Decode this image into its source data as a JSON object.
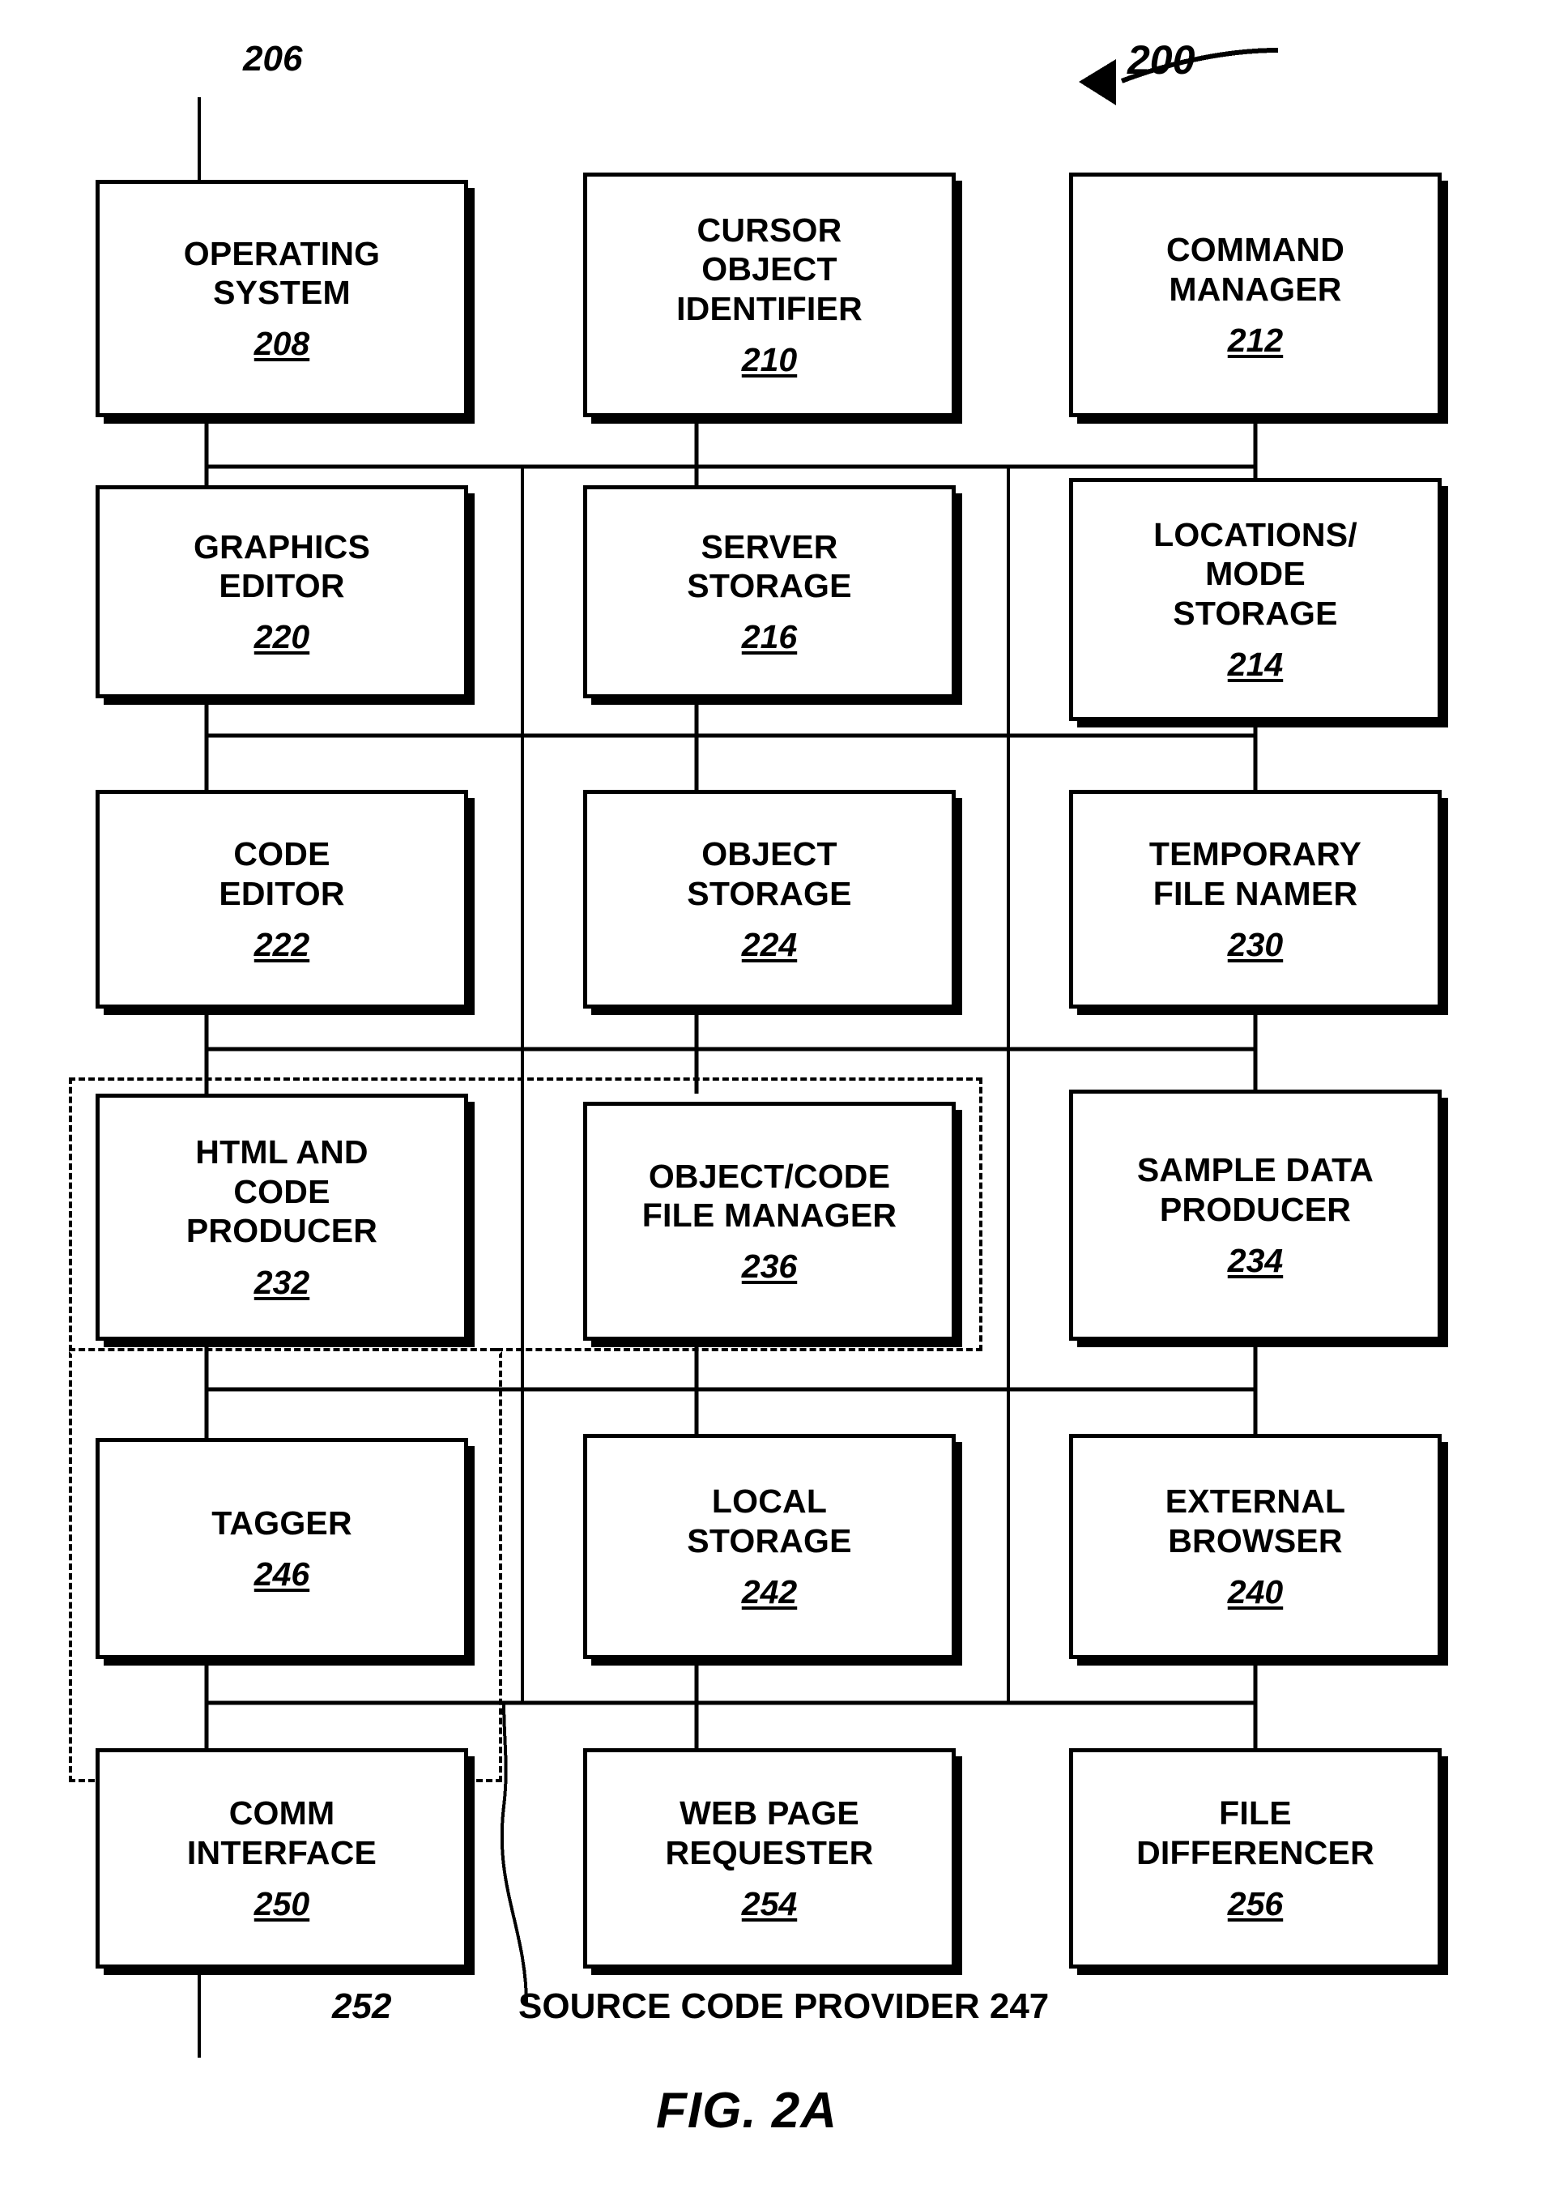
{
  "figure": {
    "caption": "FIG. 2A",
    "system_ref": "200",
    "top_left_ref": "206",
    "comm_line_ref": "252",
    "group_label": "SOURCE CODE PROVIDER 247"
  },
  "nodes": [
    {
      "id": "operating-system",
      "label": "OPERATING\nSYSTEM",
      "ref": "208",
      "row": 1,
      "col": 1
    },
    {
      "id": "cursor-object-identifier",
      "label": "CURSOR\nOBJECT\nIDENTIFIER",
      "ref": "210",
      "row": 1,
      "col": 2
    },
    {
      "id": "command-manager",
      "label": "COMMAND\nMANAGER",
      "ref": "212",
      "row": 1,
      "col": 3
    },
    {
      "id": "graphics-editor",
      "label": "GRAPHICS\nEDITOR",
      "ref": "220",
      "row": 2,
      "col": 1
    },
    {
      "id": "server-storage",
      "label": "SERVER\nSTORAGE",
      "ref": "216",
      "row": 2,
      "col": 2
    },
    {
      "id": "locations-mode-storage",
      "label": "LOCATIONS/\nMODE\nSTORAGE",
      "ref": "214",
      "row": 2,
      "col": 3
    },
    {
      "id": "code-editor",
      "label": "CODE\nEDITOR",
      "ref": "222",
      "row": 3,
      "col": 1
    },
    {
      "id": "object-storage",
      "label": "OBJECT\nSTORAGE",
      "ref": "224",
      "row": 3,
      "col": 2
    },
    {
      "id": "temporary-file-namer",
      "label": "TEMPORARY\nFILE NAMER",
      "ref": "230",
      "row": 3,
      "col": 3
    },
    {
      "id": "html-and-code-producer",
      "label": "HTML AND\nCODE\nPRODUCER",
      "ref": "232",
      "row": 4,
      "col": 1
    },
    {
      "id": "object-code-file-manager",
      "label": "OBJECT/CODE\nFILE MANAGER",
      "ref": "236",
      "row": 4,
      "col": 2
    },
    {
      "id": "sample-data-producer",
      "label": "SAMPLE DATA\nPRODUCER",
      "ref": "234",
      "row": 4,
      "col": 3
    },
    {
      "id": "tagger",
      "label": "TAGGER",
      "ref": "246",
      "row": 5,
      "col": 1
    },
    {
      "id": "local-storage",
      "label": "LOCAL\nSTORAGE",
      "ref": "242",
      "row": 5,
      "col": 2
    },
    {
      "id": "external-browser",
      "label": "EXTERNAL\nBROWSER",
      "ref": "240",
      "row": 5,
      "col": 3
    },
    {
      "id": "comm-interface",
      "label": "COMM\nINTERFACE",
      "ref": "250",
      "row": 6,
      "col": 1
    },
    {
      "id": "web-page-requester",
      "label": "WEB PAGE\nREQUESTER",
      "ref": "254",
      "row": 6,
      "col": 2
    },
    {
      "id": "file-differencer",
      "label": "FILE\nDIFFERENCER",
      "ref": "256",
      "row": 6,
      "col": 3
    }
  ],
  "colors": {
    "ink": "#000000",
    "paper": "#ffffff"
  }
}
